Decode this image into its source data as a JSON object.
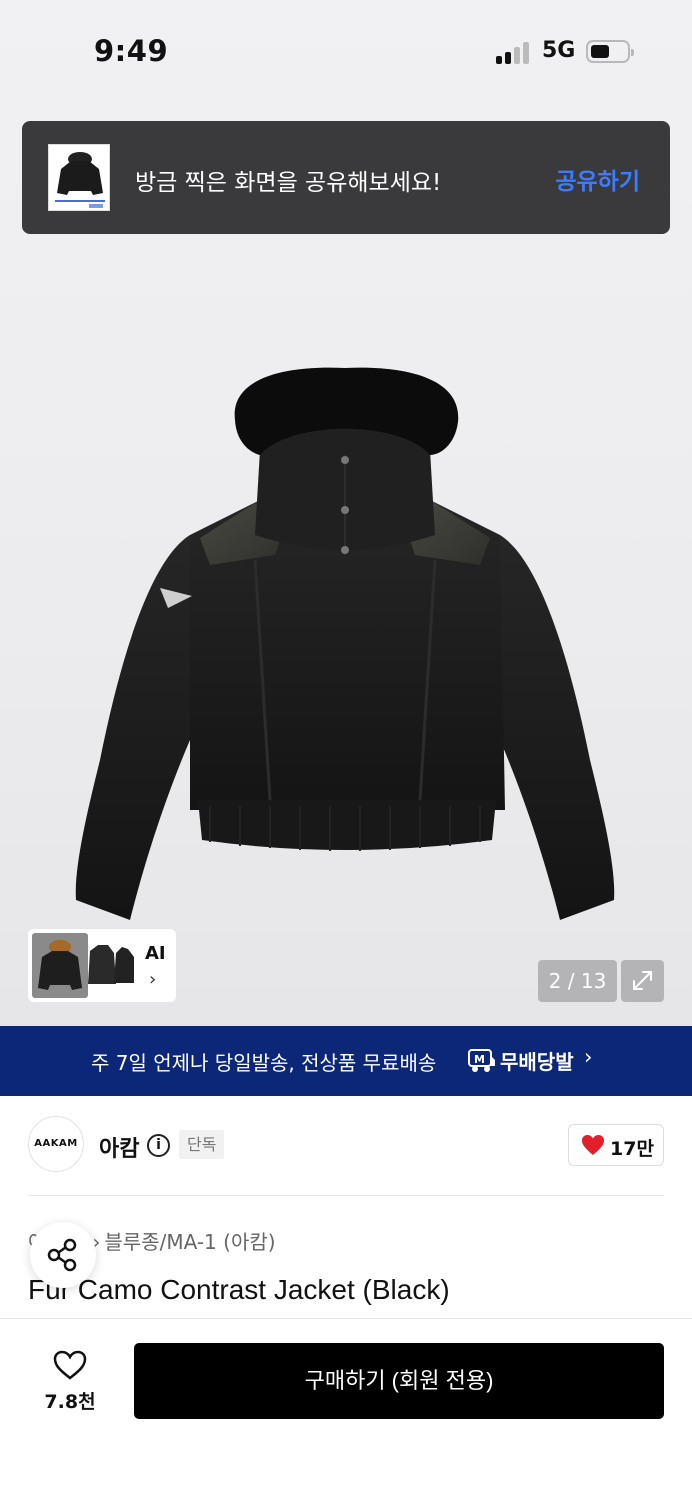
{
  "status_bar": {
    "time": "9:49",
    "network": "5G"
  },
  "share_toast": {
    "message": "방금 찍은 화면을 공유해보세요!",
    "action": "공유하기"
  },
  "gallery": {
    "ai_label": "AI",
    "counter": "2 / 13"
  },
  "delivery_banner": {
    "text": "주 7일 언제나 당일발송, 전상품 무료배송",
    "brand": "무배당발"
  },
  "brand": {
    "logo_text": "AAKAM",
    "name": "아캄",
    "exclusive_badge": "단독",
    "like_count": "17만"
  },
  "breadcrumb": {
    "category_partial": "아",
    "category": "블루종/MA-1 (아캄)"
  },
  "product": {
    "title": "Fur Camo Contrast Jacket (Black)"
  },
  "bottom_bar": {
    "wish_count": "7.8천",
    "buy_label": "구매하기 (회원 전용)"
  },
  "colors": {
    "banner_bg": "#0c2777",
    "toast_bg": "#3a3a3c",
    "accent_blue": "#3d7cff",
    "heart_red": "#e0202a",
    "buy_bg": "#000000"
  },
  "icons": [
    "signal-icon",
    "battery-icon",
    "info-icon",
    "heart-icon",
    "share-icon",
    "expand-icon",
    "chevron-right-icon",
    "delivery-badge-icon"
  ]
}
